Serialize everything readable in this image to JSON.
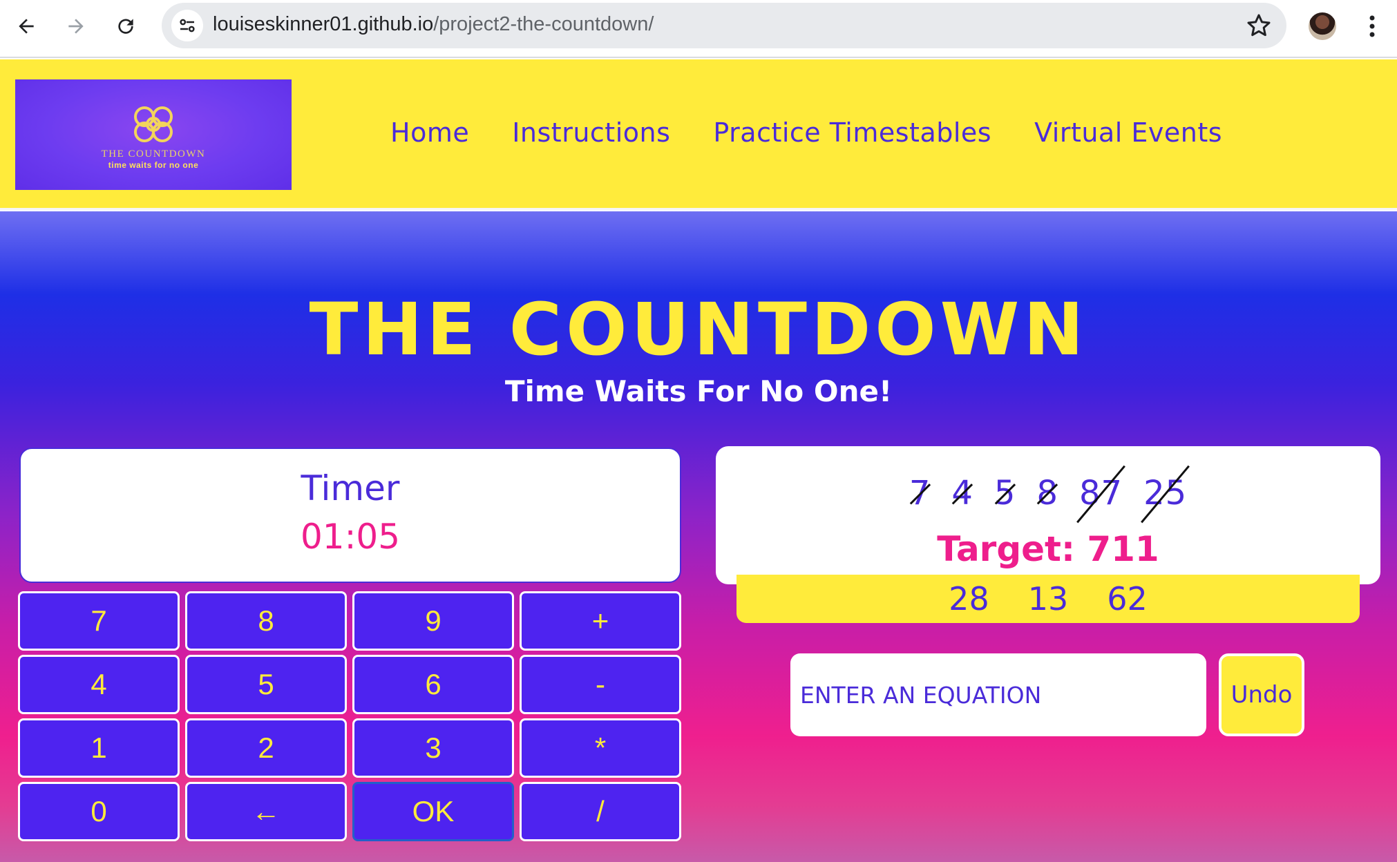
{
  "browser": {
    "url_host": "louiseskinner01.github.io",
    "url_path": "/project2-the-countdown/",
    "icons": [
      "back-arrow-icon",
      "forward-arrow-icon",
      "reload-icon",
      "site-settings-icon",
      "bookmark-star-icon",
      "profile-avatar",
      "kebab-menu-icon"
    ]
  },
  "header": {
    "logo": {
      "title": "THE COUNTDOWN",
      "tagline": "time waits for no one"
    },
    "nav": [
      "Home",
      "Instructions",
      "Practice Timestables",
      "Virtual Events"
    ]
  },
  "hero": {
    "title": "THE COUNTDOWN",
    "subtitle": "Time Waits For No One!"
  },
  "timer": {
    "label": "Timer",
    "value": "01:05"
  },
  "keypad": [
    "7",
    "8",
    "9",
    "+",
    "4",
    "5",
    "6",
    "-",
    "1",
    "2",
    "3",
    "*",
    "0",
    "←",
    "OK",
    "/"
  ],
  "numbers": {
    "selection": [
      "7",
      "4",
      "5",
      "8",
      "87",
      "25"
    ],
    "target_label": "Target: 711",
    "results": [
      "28",
      "13",
      "62"
    ]
  },
  "equation": {
    "placeholder": "ENTER AN EQUATION",
    "value": ""
  },
  "undo_label": "Undo",
  "colors": {
    "header_bg": "#ffeb3b",
    "brand_purple": "#4a2bd9",
    "key_bg": "#4e23f0",
    "accent_pink": "#ee1e8c",
    "title_yellow": "#ffeb3b"
  }
}
